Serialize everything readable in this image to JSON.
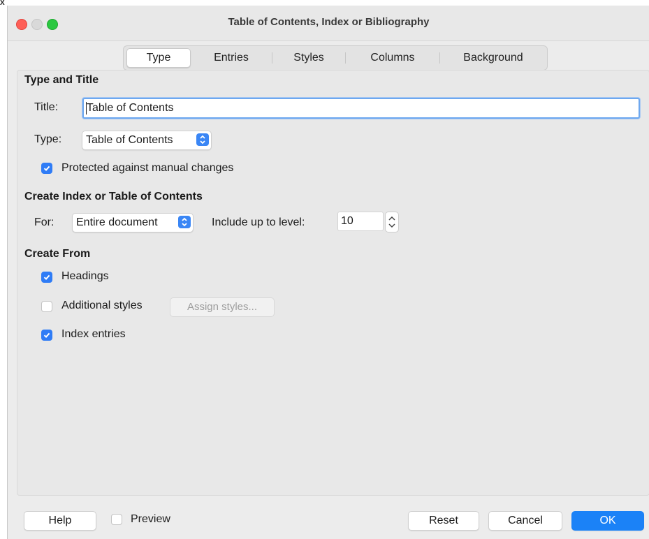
{
  "window": {
    "title": "Table of Contents, Index or Bibliography",
    "corner_fragment": "X"
  },
  "tabs": [
    {
      "label": "Type",
      "active": true
    },
    {
      "label": "Entries",
      "active": false
    },
    {
      "label": "Styles",
      "active": false
    },
    {
      "label": "Columns",
      "active": false
    },
    {
      "label": "Background",
      "active": false
    }
  ],
  "type_and_title": {
    "heading": "Type and Title",
    "title_label": "Title:",
    "title_value": "Table of Contents",
    "type_label": "Type:",
    "type_value": "Table of Contents",
    "protected_label": "Protected against manual changes",
    "protected_checked": true
  },
  "create_index": {
    "heading": "Create Index or Table of Contents",
    "for_label": "For:",
    "for_value": "Entire document",
    "level_label": "Include up to level:",
    "level_value": "10"
  },
  "create_from": {
    "heading": "Create From",
    "headings_label": "Headings",
    "headings_checked": true,
    "additional_label": "Additional styles",
    "additional_checked": false,
    "assign_label": "Assign styles...",
    "index_entries_label": "Index entries",
    "index_entries_checked": true
  },
  "footer": {
    "help_label": "Help",
    "preview_label": "Preview",
    "preview_checked": false,
    "reset_label": "Reset",
    "cancel_label": "Cancel",
    "ok_label": "OK"
  },
  "colors": {
    "accent": "#1b82f7",
    "checkbox_on": "#2f7cf6",
    "close": "#fe5f57",
    "maximize": "#2ac840"
  }
}
